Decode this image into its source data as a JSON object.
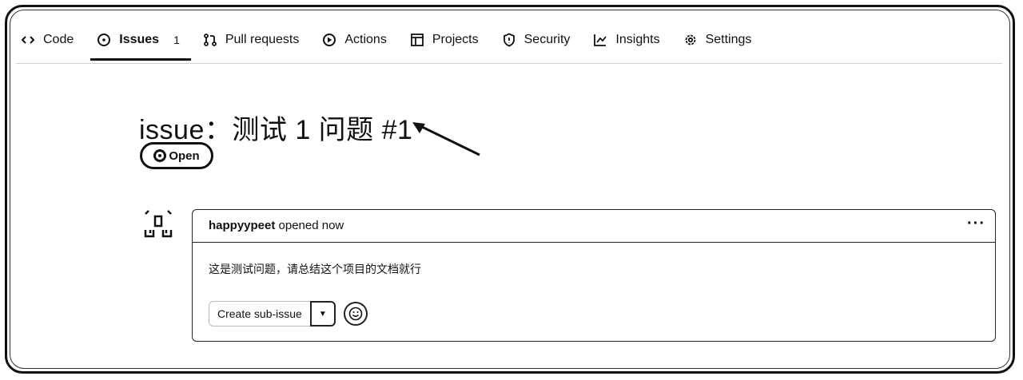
{
  "tabs": [
    {
      "label": "Code",
      "icon": "code-icon"
    },
    {
      "label": "Issues",
      "icon": "issue-opened-icon",
      "count": "1",
      "active": true
    },
    {
      "label": "Pull requests",
      "icon": "pull-request-icon"
    },
    {
      "label": "Actions",
      "icon": "play-icon"
    },
    {
      "label": "Projects",
      "icon": "table-icon"
    },
    {
      "label": "Security",
      "icon": "shield-icon"
    },
    {
      "label": "Insights",
      "icon": "graph-icon"
    },
    {
      "label": "Settings",
      "icon": "gear-icon"
    }
  ],
  "issue": {
    "title": "issue：测试 1 问题 #1",
    "state": "Open"
  },
  "comment": {
    "author": "happyypeet",
    "action": "opened now",
    "more": "···",
    "body": "这是测试问题，请总结这个项目的文档就行",
    "create_sub_issue": "Create sub-issue"
  }
}
